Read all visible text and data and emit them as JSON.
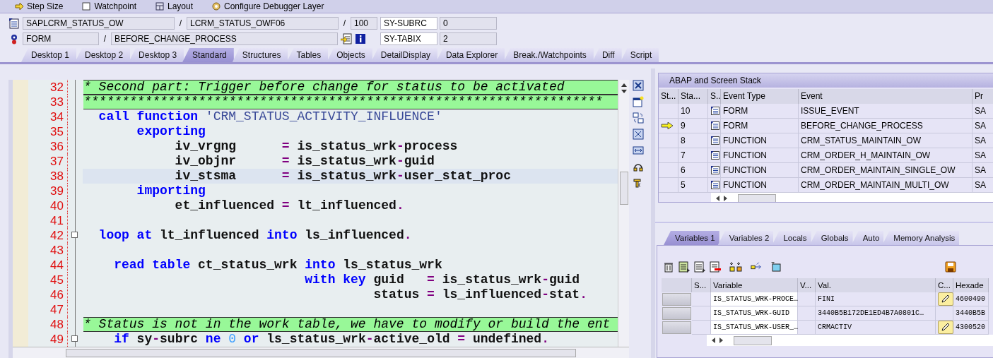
{
  "toolbar": [
    {
      "label": "Step Size"
    },
    {
      "label": "Watchpoint"
    },
    {
      "label": "Layout"
    },
    {
      "label": "Configure Debugger Layer"
    }
  ],
  "location": [
    {
      "kind": "program",
      "items": [
        {
          "kind": "field",
          "text": "SAPLCRM_STATUS_OW"
        },
        {
          "kind": "sep",
          "text": "/"
        },
        {
          "kind": "field",
          "text": "LCRM_STATUS_OWF06"
        },
        {
          "kind": "sep",
          "text": "/"
        },
        {
          "kind": "short",
          "text": "100"
        }
      ],
      "sys_name": "SY-SUBRC",
      "sys_value": "0"
    },
    {
      "kind": "event",
      "items": [
        {
          "kind": "small",
          "text": "FORM"
        },
        {
          "kind": "sep",
          "text": "/"
        },
        {
          "kind": "wide",
          "text": "BEFORE_CHANGE_PROCESS"
        }
      ],
      "sys_name": "SY-TABIX",
      "sys_value": "2"
    }
  ],
  "tabs": [
    {
      "label": "Desktop 1",
      "selected": false
    },
    {
      "label": "Desktop 2",
      "selected": false
    },
    {
      "label": "Desktop 3",
      "selected": false
    },
    {
      "label": "Standard",
      "selected": true
    },
    {
      "label": "Structures",
      "selected": false
    },
    {
      "label": "Tables",
      "selected": false
    },
    {
      "label": "Objects",
      "selected": false
    },
    {
      "label": "DetailDisplay",
      "selected": false
    },
    {
      "label": "Data Explorer",
      "selected": false
    },
    {
      "label": "Break./Watchpoints",
      "selected": false
    },
    {
      "label": "Diff",
      "selected": false
    },
    {
      "label": "Script",
      "selected": false
    }
  ],
  "code": {
    "lines": [
      {
        "number": "32",
        "kind": "comment",
        "current": false,
        "fold": false,
        "text": "* Second part: Trigger before change for status to be activated"
      },
      {
        "number": "33",
        "kind": "comment",
        "current": false,
        "fold": false,
        "text": "********************************************************************"
      },
      {
        "number": "34",
        "kind": "code",
        "current": false,
        "fold": false,
        "tokens": [
          {
            "kind": "kw",
            "text": "  call"
          },
          {
            "kind": "kw",
            "text": " function"
          },
          {
            "kind": "str",
            "text": " 'CRM_STATUS_ACTIVITY_INFLUENCE'"
          }
        ]
      },
      {
        "number": "35",
        "kind": "code",
        "current": false,
        "fold": false,
        "tokens": [
          {
            "kind": "kw",
            "text": "       exporting"
          }
        ]
      },
      {
        "number": "36",
        "kind": "code",
        "current": false,
        "fold": false,
        "tokens": [
          {
            "kind": "id",
            "text": "            iv_vrgng      "
          },
          {
            "kind": "op",
            "text": "="
          },
          {
            "kind": "id",
            "text": " is_status_wrk"
          },
          {
            "kind": "op",
            "text": "-"
          },
          {
            "kind": "id",
            "text": "process"
          }
        ]
      },
      {
        "number": "37",
        "kind": "code",
        "current": false,
        "fold": false,
        "tokens": [
          {
            "kind": "id",
            "text": "            iv_objnr      "
          },
          {
            "kind": "op",
            "text": "="
          },
          {
            "kind": "id",
            "text": " is_status_wrk"
          },
          {
            "kind": "op",
            "text": "-"
          },
          {
            "kind": "id",
            "text": "guid"
          }
        ]
      },
      {
        "number": "38",
        "kind": "code",
        "current": true,
        "fold": false,
        "tokens": [
          {
            "kind": "id",
            "text": "            iv_stsma      "
          },
          {
            "kind": "op",
            "text": "="
          },
          {
            "kind": "id",
            "text": " is_status_wrk"
          },
          {
            "kind": "op",
            "text": "-"
          },
          {
            "kind": "id",
            "text": "user_stat_proc"
          }
        ]
      },
      {
        "number": "39",
        "kind": "code",
        "current": false,
        "fold": false,
        "tokens": [
          {
            "kind": "kw",
            "text": "       importing"
          }
        ]
      },
      {
        "number": "40",
        "kind": "code",
        "current": false,
        "fold": false,
        "tokens": [
          {
            "kind": "id",
            "text": "            et_influenced "
          },
          {
            "kind": "op",
            "text": "="
          },
          {
            "kind": "id",
            "text": " lt_influenced"
          },
          {
            "kind": "op",
            "text": "."
          }
        ]
      },
      {
        "number": "41",
        "kind": "code",
        "current": false,
        "fold": false
      },
      {
        "number": "42",
        "kind": "code",
        "current": false,
        "fold": true,
        "tokens": [
          {
            "kind": "kw",
            "text": "  loop"
          },
          {
            "kind": "kw",
            "text": " at"
          },
          {
            "kind": "id",
            "text": " lt_influenced"
          },
          {
            "kind": "kw",
            "text": " into"
          },
          {
            "kind": "id",
            "text": " ls_influenced"
          },
          {
            "kind": "op",
            "text": "."
          }
        ]
      },
      {
        "number": "43",
        "kind": "code",
        "current": false,
        "fold": false
      },
      {
        "number": "44",
        "kind": "code",
        "current": false,
        "fold": false,
        "tokens": [
          {
            "kind": "kw",
            "text": "    read"
          },
          {
            "kind": "kw",
            "text": " table"
          },
          {
            "kind": "id",
            "text": " ct_status_wrk"
          },
          {
            "kind": "kw",
            "text": " into"
          },
          {
            "kind": "id",
            "text": " ls_status_wrk"
          }
        ]
      },
      {
        "number": "45",
        "kind": "code",
        "current": false,
        "fold": false,
        "tokens": [
          {
            "kind": "kw",
            "text": "                             with"
          },
          {
            "kind": "kw",
            "text": " key"
          },
          {
            "kind": "id",
            "text": " guid   "
          },
          {
            "kind": "op",
            "text": "="
          },
          {
            "kind": "id",
            "text": " is_status_wrk"
          },
          {
            "kind": "op",
            "text": "-"
          },
          {
            "kind": "id",
            "text": "guid"
          }
        ]
      },
      {
        "number": "46",
        "kind": "code",
        "current": false,
        "fold": false,
        "tokens": [
          {
            "kind": "id",
            "text": "                                      status "
          },
          {
            "kind": "op",
            "text": "="
          },
          {
            "kind": "id",
            "text": " ls_influenced"
          },
          {
            "kind": "op",
            "text": "-"
          },
          {
            "kind": "id",
            "text": "stat"
          },
          {
            "kind": "op",
            "text": "."
          }
        ]
      },
      {
        "number": "47",
        "kind": "code",
        "current": false,
        "fold": false
      },
      {
        "number": "48",
        "kind": "comment",
        "current": false,
        "fold": false,
        "text": "* Status is not in the work table, we have to modify or build the ent"
      },
      {
        "number": "49",
        "kind": "code",
        "current": false,
        "fold": true,
        "tokens": [
          {
            "kind": "kw",
            "text": "    if"
          },
          {
            "kind": "id",
            "text": " sy"
          },
          {
            "kind": "op",
            "text": "-"
          },
          {
            "kind": "id",
            "text": "subrc"
          },
          {
            "kind": "kw",
            "text": " ne"
          },
          {
            "kind": "num",
            "text": " 0"
          },
          {
            "kind": "kw",
            "text": " or"
          },
          {
            "kind": "id",
            "text": " ls_status_wrk"
          },
          {
            "kind": "op",
            "text": "-"
          },
          {
            "kind": "id",
            "text": "active_old"
          },
          {
            "kind": "op",
            "text": " ="
          },
          {
            "kind": "id",
            "text": " undefined"
          },
          {
            "kind": "op",
            "text": "."
          }
        ]
      }
    ]
  },
  "stack": {
    "title": "ABAP and Screen Stack",
    "columns": [
      "St...",
      "Sta...",
      "S..",
      "Event Type",
      "Event",
      "Pr"
    ],
    "rows": [
      {
        "current": false,
        "stack_level": "10",
        "event_type": "FORM",
        "event": "ISSUE_EVENT",
        "column_6": "SA"
      },
      {
        "current": true,
        "stack_level": "9",
        "event_type": "FORM",
        "event": "BEFORE_CHANGE_PROCESS",
        "column_6": "SA"
      },
      {
        "current": false,
        "stack_level": "8",
        "event_type": "FUNCTION",
        "event": "CRM_STATUS_MAINTAIN_OW",
        "column_6": "SA"
      },
      {
        "current": false,
        "stack_level": "7",
        "event_type": "FUNCTION",
        "event": "CRM_ORDER_H_MAINTAIN_OW",
        "column_6": "SA"
      },
      {
        "current": false,
        "stack_level": "6",
        "event_type": "FUNCTION",
        "event": "CRM_ORDER_MAINTAIN_SINGLE_OW",
        "column_6": "SA"
      },
      {
        "current": false,
        "stack_level": "5",
        "event_type": "FUNCTION",
        "event": "CRM_ORDER_MAINTAIN_MULTI_OW",
        "column_6": "SA"
      }
    ]
  },
  "variables": {
    "tabs": [
      {
        "label": "Variables 1",
        "selected": true
      },
      {
        "label": "Variables 2",
        "selected": false
      },
      {
        "label": "Locals",
        "selected": false
      },
      {
        "label": "Globals",
        "selected": false
      },
      {
        "label": "Auto",
        "selected": false
      },
      {
        "label": "Memory Analysis",
        "selected": false
      }
    ],
    "columns": [
      "S...",
      "Variable",
      "V...",
      "Val.",
      "C...",
      "Hexade"
    ],
    "rows": [
      {
        "variable": "IS_STATUS_WRK-PROCE…",
        "value": "FINI",
        "changeable": true,
        "hex": "4600490"
      },
      {
        "variable": "IS_STATUS_WRK-GUID",
        "value": "3440B5B172DE1ED4B7A0801C…",
        "changeable": false,
        "hex": "3440B5B"
      },
      {
        "variable": "IS_STATUS_WRK-USER_…",
        "value": "CRMACTIV",
        "changeable": true,
        "hex": "4300520"
      }
    ]
  }
}
